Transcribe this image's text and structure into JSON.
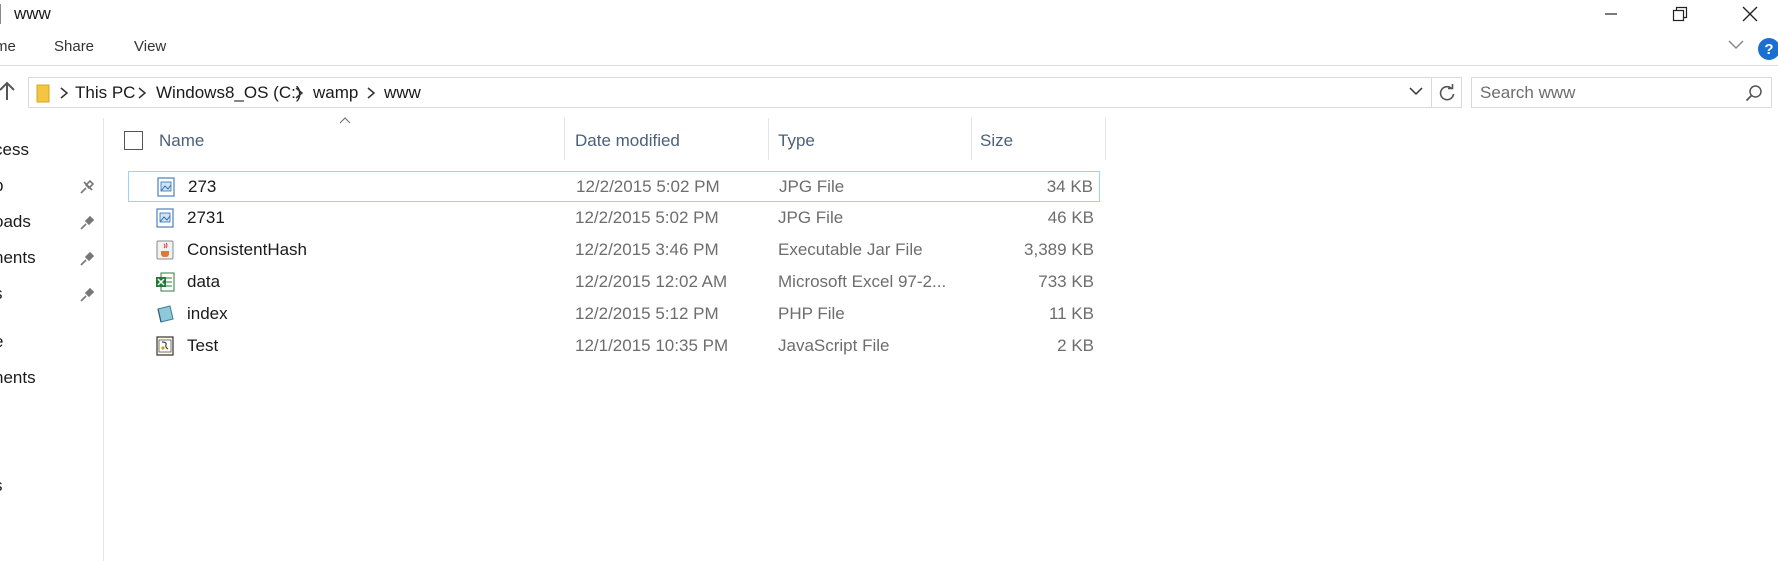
{
  "window": {
    "title": "www",
    "minimize_glyph": "—",
    "close_glyph": "✕"
  },
  "ribbon": {
    "tabs": [
      {
        "label": "Home",
        "visible_label": "me"
      },
      {
        "label": "Share"
      },
      {
        "label": "View"
      }
    ]
  },
  "address": {
    "crumbs": [
      "This PC",
      "Windows8_OS (C:)",
      "wamp",
      "www"
    ]
  },
  "search": {
    "placeholder": "Search www"
  },
  "nav": {
    "items": [
      {
        "label": "cess",
        "pinned": false
      },
      {
        "label": "p",
        "pinned": true
      },
      {
        "label": "oads",
        "pinned": true
      },
      {
        "label": "nents",
        "pinned": true
      },
      {
        "label": "s",
        "pinned": true
      },
      {
        "label": "e",
        "pinned": false
      },
      {
        "label": "nents",
        "pinned": false
      },
      {
        "label": "s",
        "pinned": false
      }
    ]
  },
  "columns": {
    "name": "Name",
    "date": "Date modified",
    "type": "Type",
    "size": "Size"
  },
  "files": [
    {
      "name": "273",
      "date": "12/2/2015 5:02 PM",
      "type": "JPG File",
      "size": "34 KB",
      "icon": "jpg-file-icon",
      "selected": true
    },
    {
      "name": "2731",
      "date": "12/2/2015 5:02 PM",
      "type": "JPG File",
      "size": "46 KB",
      "icon": "jpg-file-icon",
      "selected": false
    },
    {
      "name": "ConsistentHash",
      "date": "12/2/2015 3:46 PM",
      "type": "Executable Jar File",
      "size": "3,389 KB",
      "icon": "jar-file-icon",
      "selected": false
    },
    {
      "name": "data",
      "date": "12/2/2015 12:02 AM",
      "type": "Microsoft Excel 97-2...",
      "size": "733 KB",
      "icon": "excel-file-icon",
      "selected": false
    },
    {
      "name": "index",
      "date": "12/2/2015 5:12 PM",
      "type": "PHP File",
      "size": "11 KB",
      "icon": "php-file-icon",
      "selected": false
    },
    {
      "name": "Test",
      "date": "12/1/2015 10:35 PM",
      "type": "JavaScript File",
      "size": "2 KB",
      "icon": "js-file-icon",
      "selected": false
    }
  ],
  "colors": {
    "accent": "#1a6fd1",
    "header_text": "#4c607a",
    "selection_border": "#99d1ff",
    "folder": "#f4c542"
  }
}
